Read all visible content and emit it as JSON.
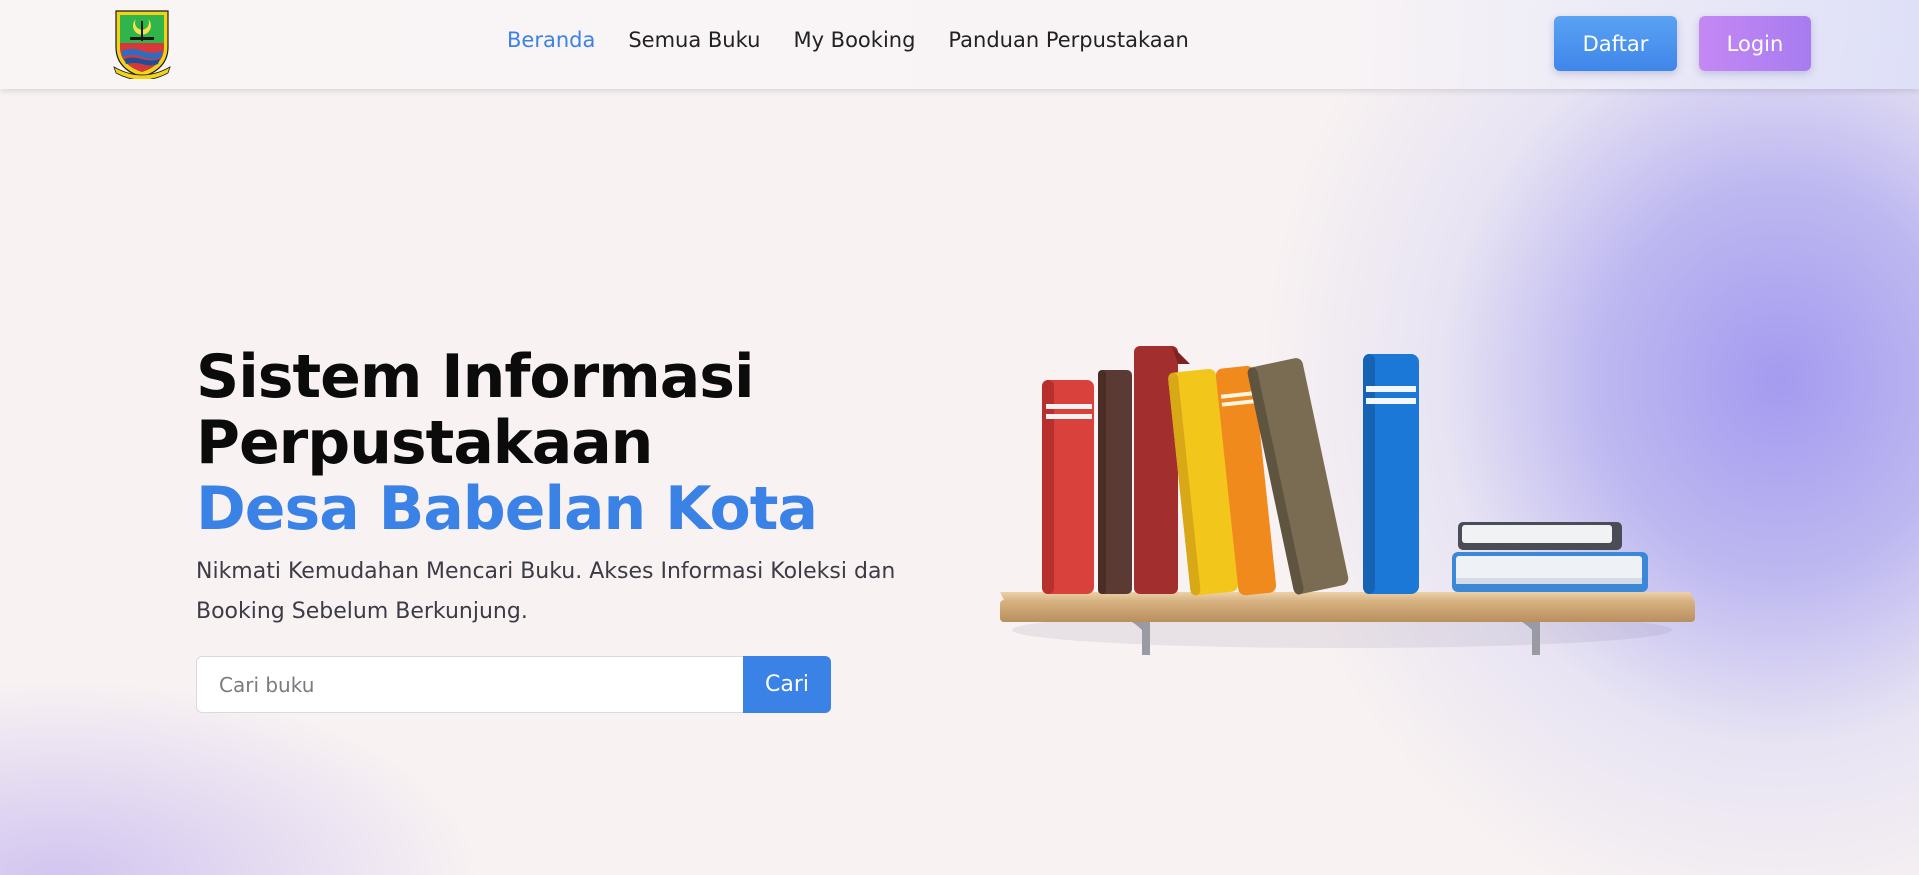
{
  "nav": {
    "items": [
      {
        "label": "Beranda",
        "active": true
      },
      {
        "label": "Semua Buku",
        "active": false
      },
      {
        "label": "My Booking",
        "active": false
      },
      {
        "label": "Panduan Perpustakaan",
        "active": false
      }
    ],
    "register_label": "Daftar",
    "login_label": "Login"
  },
  "hero": {
    "title_line1": "Sistem Informasi",
    "title_line2": "Perpustakaan",
    "title_line3": "Desa Babelan Kota",
    "description": "Nikmati Kemudahan Mencari Buku. Akses Informasi Koleksi dan Booking Sebelum Berkunjung.",
    "search": {
      "placeholder": "Cari buku",
      "value": "",
      "button_label": "Cari"
    }
  },
  "colors": {
    "accent": "#3b82e6",
    "login_button": "#b184f2",
    "register_button": "#4f93ee"
  },
  "icons": {
    "logo": "municipal-crest-logo",
    "illustration": "bookshelf-illustration"
  }
}
